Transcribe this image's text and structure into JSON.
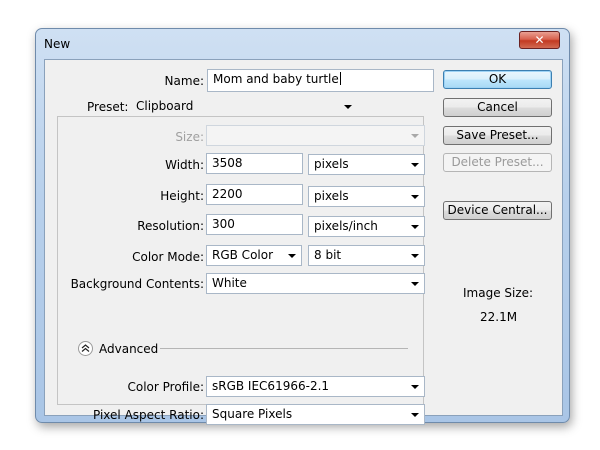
{
  "window": {
    "title": "New",
    "close_glyph": "✕"
  },
  "form": {
    "name": {
      "label": "Name:",
      "value": "Mom and baby turtle"
    },
    "preset": {
      "label": "Preset:",
      "value": "Clipboard"
    },
    "size": {
      "label": "Size:",
      "value": ""
    },
    "width": {
      "label": "Width:",
      "value": "3508",
      "unit": "pixels"
    },
    "height": {
      "label": "Height:",
      "value": "2200",
      "unit": "pixels"
    },
    "resolution": {
      "label": "Resolution:",
      "value": "300",
      "unit": "pixels/inch"
    },
    "color_mode": {
      "label": "Color Mode:",
      "value": "RGB Color",
      "bit_depth": "8 bit"
    },
    "background": {
      "label": "Background Contents:",
      "value": "White"
    },
    "advanced": {
      "label": "Advanced"
    },
    "color_profile": {
      "label": "Color Profile:",
      "value": "sRGB IEC61966-2.1"
    },
    "pixel_aspect": {
      "label": "Pixel Aspect Ratio:",
      "value": "Square Pixels"
    }
  },
  "buttons": {
    "ok": "OK",
    "cancel": "Cancel",
    "save_preset": "Save Preset...",
    "delete_preset": "Delete Preset...",
    "device_central": "Device Central..."
  },
  "image_size": {
    "label": "Image Size:",
    "value": "22.1M"
  },
  "colors": {
    "window_frame": "#b9d1ec",
    "client_bg": "#f0f0f0",
    "default_button": "#bee6fd",
    "close_button": "#c23a22"
  },
  "icons": [
    "close-icon",
    "dropdown-arrow-icon",
    "collapse-chevron-icon"
  ]
}
